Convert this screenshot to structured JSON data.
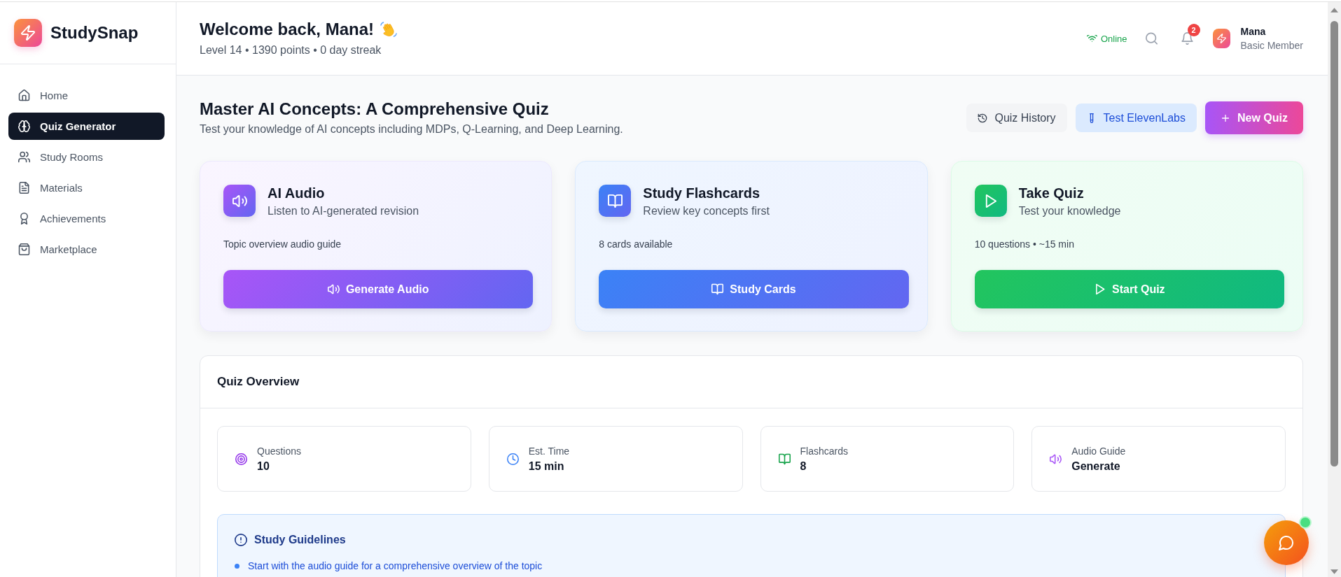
{
  "sidebar": {
    "brand": "StudySnap",
    "items": [
      {
        "label": "Home",
        "selected": false
      },
      {
        "label": "Quiz Generator",
        "selected": true
      },
      {
        "label": "Study Rooms",
        "selected": false
      },
      {
        "label": "Materials",
        "selected": false
      },
      {
        "label": "Achievements",
        "selected": false
      },
      {
        "label": "Marketplace",
        "selected": false
      }
    ]
  },
  "header": {
    "greeting": "Welcome back, Mana!",
    "stats_line": "Level 14 • 1390 points • 0 day streak",
    "status": "Online",
    "notification_count": "2",
    "user": {
      "name": "Mana",
      "membership": "Basic Member"
    }
  },
  "quiz": {
    "title": "Master AI Concepts: A Comprehensive Quiz",
    "subtitle": "Test your knowledge of AI concepts including MDPs, Q-Learning, and Deep Learning.",
    "actions": [
      "Quiz History",
      "Test ElevenLabs",
      "New Quiz"
    ]
  },
  "cards": [
    {
      "title": "AI Audio",
      "subtitle": "Listen to AI-generated revision",
      "detail": "Topic overview audio guide",
      "button": "Generate Audio"
    },
    {
      "title": "Study Flashcards",
      "subtitle": "Review key concepts first",
      "detail": "8 cards available",
      "button": "Study Cards"
    },
    {
      "title": "Take Quiz",
      "subtitle": "Test your knowledge",
      "detail": "10 questions • ~15 min",
      "button": "Start Quiz"
    }
  ],
  "overview": {
    "title": "Quiz Overview",
    "stats": [
      {
        "label": "Questions",
        "value": "10"
      },
      {
        "label": "Est. Time",
        "value": "15 min"
      },
      {
        "label": "Flashcards",
        "value": "8"
      },
      {
        "label": "Audio Guide",
        "value": "Generate"
      }
    ],
    "guidelines": {
      "title": "Study Guidelines",
      "items": [
        "Start with the audio guide for a comprehensive overview of the topic"
      ]
    }
  }
}
